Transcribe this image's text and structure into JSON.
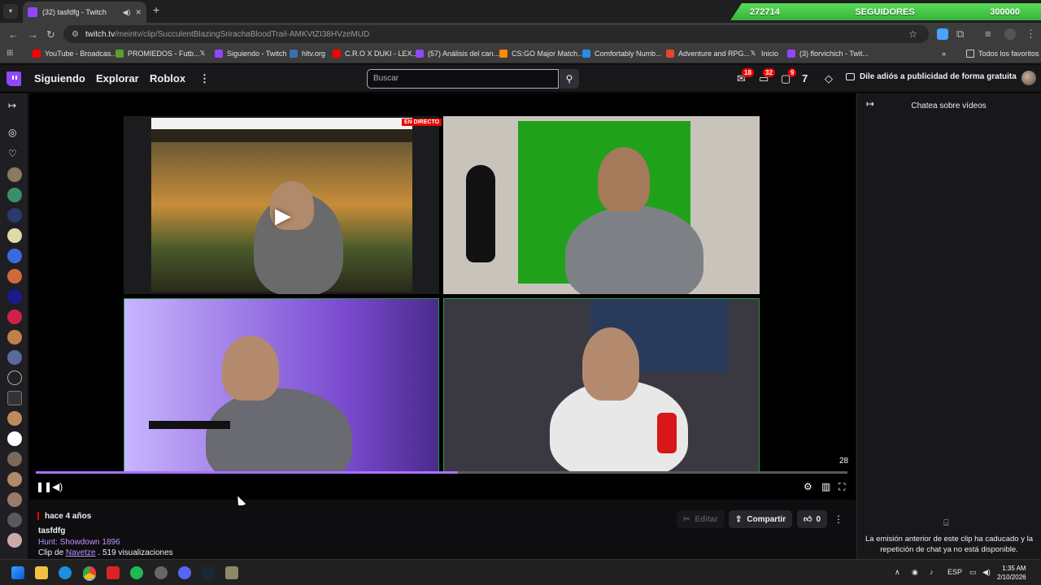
{
  "browser": {
    "tab_title": "(32) tasfdfg - Twitch",
    "url_host": "twitch.tv",
    "url_path": "/meintv/clip/SucculentBlazingSrirachaBloodTrail-AMKVtZI38HVzeMUD",
    "bookmarks": [
      "YouTube - Broadcas...",
      "PROMIEDOS - Futb...",
      "",
      "Siguiendo - Twitch",
      "hltv.org",
      "C.R.O X DUKI - LEX...",
      "(57) Análisis del can...",
      "CS:GO Major Match...",
      "Comfortably Numb...",
      "Adventure and RPG...",
      "Inicio",
      "(3) florvichich - Twit..."
    ],
    "bookmarks_overflow": "»",
    "all_bookmarks": "Todos los favoritos"
  },
  "follower_bar": {
    "count": "272714",
    "label": "SEGUIDORES",
    "goal": "300000",
    "progress": 0.909,
    "color": "#3fc23c"
  },
  "twitch_nav": {
    "following": "Siguiendo",
    "browse": "Explorar",
    "roblox": "Roblox",
    "search_placeholder": "Buscar",
    "badge_inbox": "18",
    "badge_whispers": "32",
    "badge_notifications": "9",
    "adfree": "Dile adiós a publicidad de forma gratuita"
  },
  "player": {
    "live_badge": "EN DIRECTO",
    "counter": "28",
    "progress": 0.52,
    "accent": "#a970ff"
  },
  "clip": {
    "ago": "hace 4 años",
    "title": "tasfdfg",
    "game": "Hunt: Showdown 1896",
    "clip_by_prefix": "Clip de",
    "clipper": "Navetze",
    "views": ". 519 visualizaciones",
    "edit": "Editar",
    "share": "Compartir",
    "likes": "0"
  },
  "chat": {
    "title": "Chatea sobre vídeos",
    "message": "La emisión anterior de este clip ha caducado y la repetición de chat ya no está disponible."
  },
  "taskbar": {
    "lang": "ESP",
    "time": "1:35 AM",
    "date": "2/10/2026"
  }
}
